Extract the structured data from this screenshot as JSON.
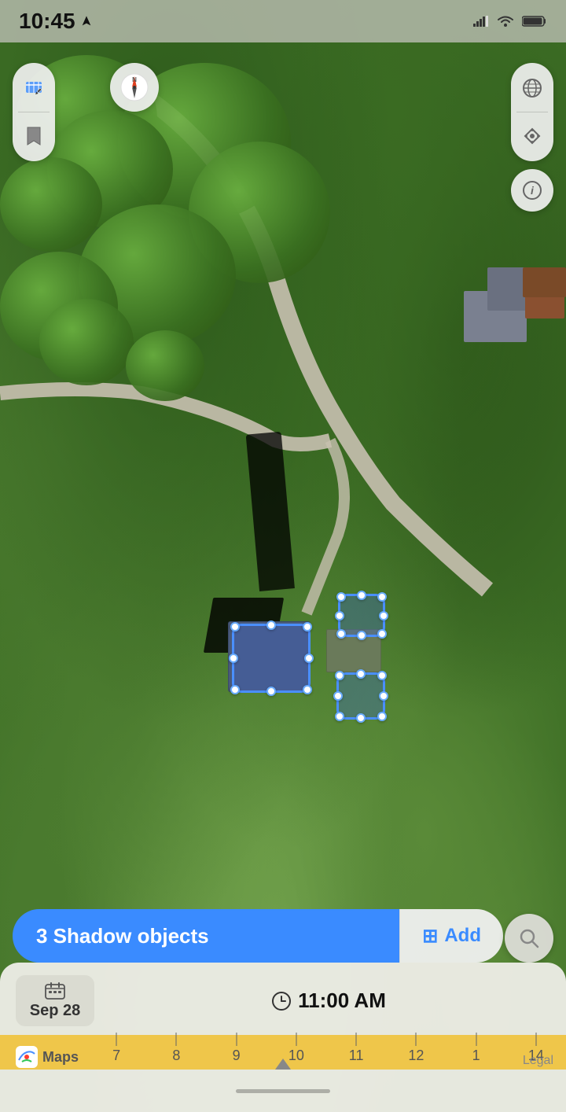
{
  "status_bar": {
    "time": "10:45",
    "location_icon": "▶",
    "wifi_icon": "wifi",
    "battery_icon": "battery"
  },
  "map": {
    "compass_label": "N",
    "compass_needle": "▲"
  },
  "controls": {
    "tool_icon": "tool",
    "bookmark_icon": "bookmark",
    "globe_icon": "globe",
    "location_icon": "location",
    "info_icon": "info",
    "search_icon": "search"
  },
  "action_bar": {
    "shadow_objects_label": "3 Shadow objects",
    "add_label": "Add",
    "add_icon": "⊞"
  },
  "timeline": {
    "date_icon": "calendar",
    "date_label": "Sep 28",
    "time_icon": "clock",
    "time_label": "11:00 AM",
    "hours": [
      "7",
      "8",
      "9",
      "10",
      "11",
      "12",
      "1",
      "14"
    ],
    "current_hour": "11"
  },
  "branding": {
    "maps_label": "Maps",
    "legal_label": "Legal"
  }
}
